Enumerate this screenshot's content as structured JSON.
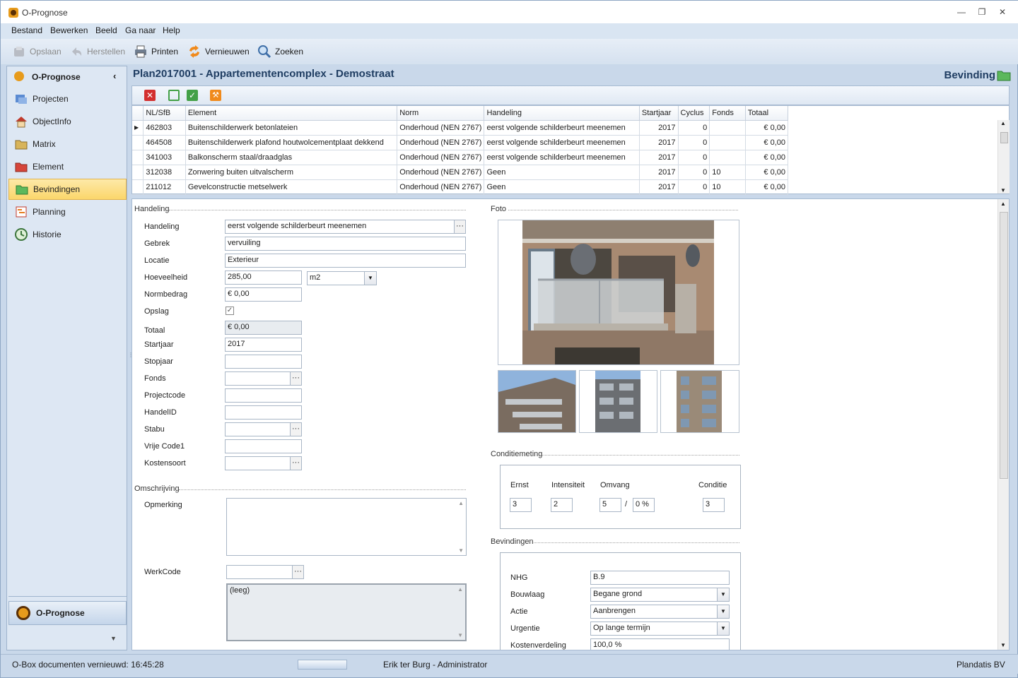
{
  "window": {
    "title": "O-Prognose"
  },
  "menu": [
    "Bestand",
    "Bewerken",
    "Beeld",
    "Ga naar",
    "Help"
  ],
  "toolbar": {
    "save": "Opslaan",
    "restore": "Herstellen",
    "print": "Printen",
    "refresh": "Vernieuwen",
    "search": "Zoeken"
  },
  "nav": {
    "header": "O-Prognose",
    "items": [
      "Projecten",
      "ObjectInfo",
      "Matrix",
      "Element",
      "Bevindingen",
      "Planning",
      "Historie"
    ],
    "selected": "Bevindingen",
    "bottom": "O-Prognose"
  },
  "page": {
    "title": "Plan2017001 - Appartementencomplex - Demostraat",
    "section": "Bevinding"
  },
  "grid": {
    "columns": [
      "NL/SfB",
      "Element",
      "Norm",
      "Handeling",
      "Startjaar",
      "Cyclus",
      "Fonds",
      "Totaal"
    ],
    "rows": [
      [
        "462803",
        "Buitenschilderwerk betonlateien",
        "Onderhoud (NEN 2767)",
        "eerst volgende schilderbeurt meenemen",
        "2017",
        "0",
        "",
        "€ 0,00"
      ],
      [
        "464508",
        "Buitenschilderwerk plafond houtwolcementplaat dekkend",
        "Onderhoud (NEN 2767)",
        "eerst volgende schilderbeurt meenemen",
        "2017",
        "0",
        "",
        "€ 0,00"
      ],
      [
        "341003",
        "Balkonscherm staal/draadglas",
        "Onderhoud (NEN 2767)",
        "eerst volgende schilderbeurt meenemen",
        "2017",
        "0",
        "",
        "€ 0,00"
      ],
      [
        "312038",
        "Zonwering buiten uitvalscherm",
        "Onderhoud (NEN 2767)",
        "Geen",
        "2017",
        "0",
        "10",
        "€ 0,00"
      ],
      [
        "211012",
        "Gevelconstructie metselwerk",
        "Onderhoud (NEN 2767)",
        "Geen",
        "2017",
        "0",
        "10",
        "€ 0,00"
      ]
    ]
  },
  "handeling": {
    "section": "Handeling",
    "labels": {
      "handeling": "Handeling",
      "gebrek": "Gebrek",
      "locatie": "Locatie",
      "hoeveelheid": "Hoeveelheid",
      "normbedrag": "Normbedrag",
      "opslag": "Opslag",
      "totaal": "Totaal",
      "startjaar": "Startjaar",
      "stopjaar": "Stopjaar",
      "fonds": "Fonds",
      "projectcode": "Projectcode",
      "handelid": "HandelID",
      "stabu": "Stabu",
      "vrijecode1": "Vrije Code1",
      "kostensoort": "Kostensoort"
    },
    "values": {
      "handeling": "eerst volgende schilderbeurt meenemen",
      "gebrek": "vervuiling",
      "locatie": "Exterieur",
      "hoeveelheid": "285,00",
      "eenheid": "m2",
      "normbedrag": "€ 0,00",
      "totaal": "€ 0,00",
      "startjaar": "2017"
    }
  },
  "omschrijving": {
    "section": "Omschrijving",
    "opmerking": "Opmerking",
    "werkcode": "WerkCode",
    "leeg": "(leeg)"
  },
  "foto": {
    "section": "Foto"
  },
  "conditiemeting": {
    "section": "Conditiemeting",
    "labels": {
      "ernst": "Ernst",
      "intensiteit": "Intensiteit",
      "omvang": "Omvang",
      "conditie": "Conditie"
    },
    "values": {
      "ernst": "3",
      "intensiteit": "2",
      "omvang": "5",
      "omvang_pct": "0 %",
      "conditie": "3"
    },
    "sep": "/"
  },
  "bevindingen": {
    "section": "Bevindingen",
    "labels": {
      "nhg": "NHG",
      "bouwlaag": "Bouwlaag",
      "actie": "Actie",
      "urgentie": "Urgentie",
      "kostenverdeling": "Kostenverdeling"
    },
    "values": {
      "nhg": "B.9",
      "bouwlaag": "Begane grond",
      "actie": "Aanbrengen",
      "urgentie": "Op lange termijn",
      "kostenverdeling": "100,0 %"
    }
  },
  "status": {
    "left": "O-Box documenten vernieuwd: 16:45:28",
    "user": "Erik ter Burg - Administrator",
    "company": "Plandatis BV"
  }
}
